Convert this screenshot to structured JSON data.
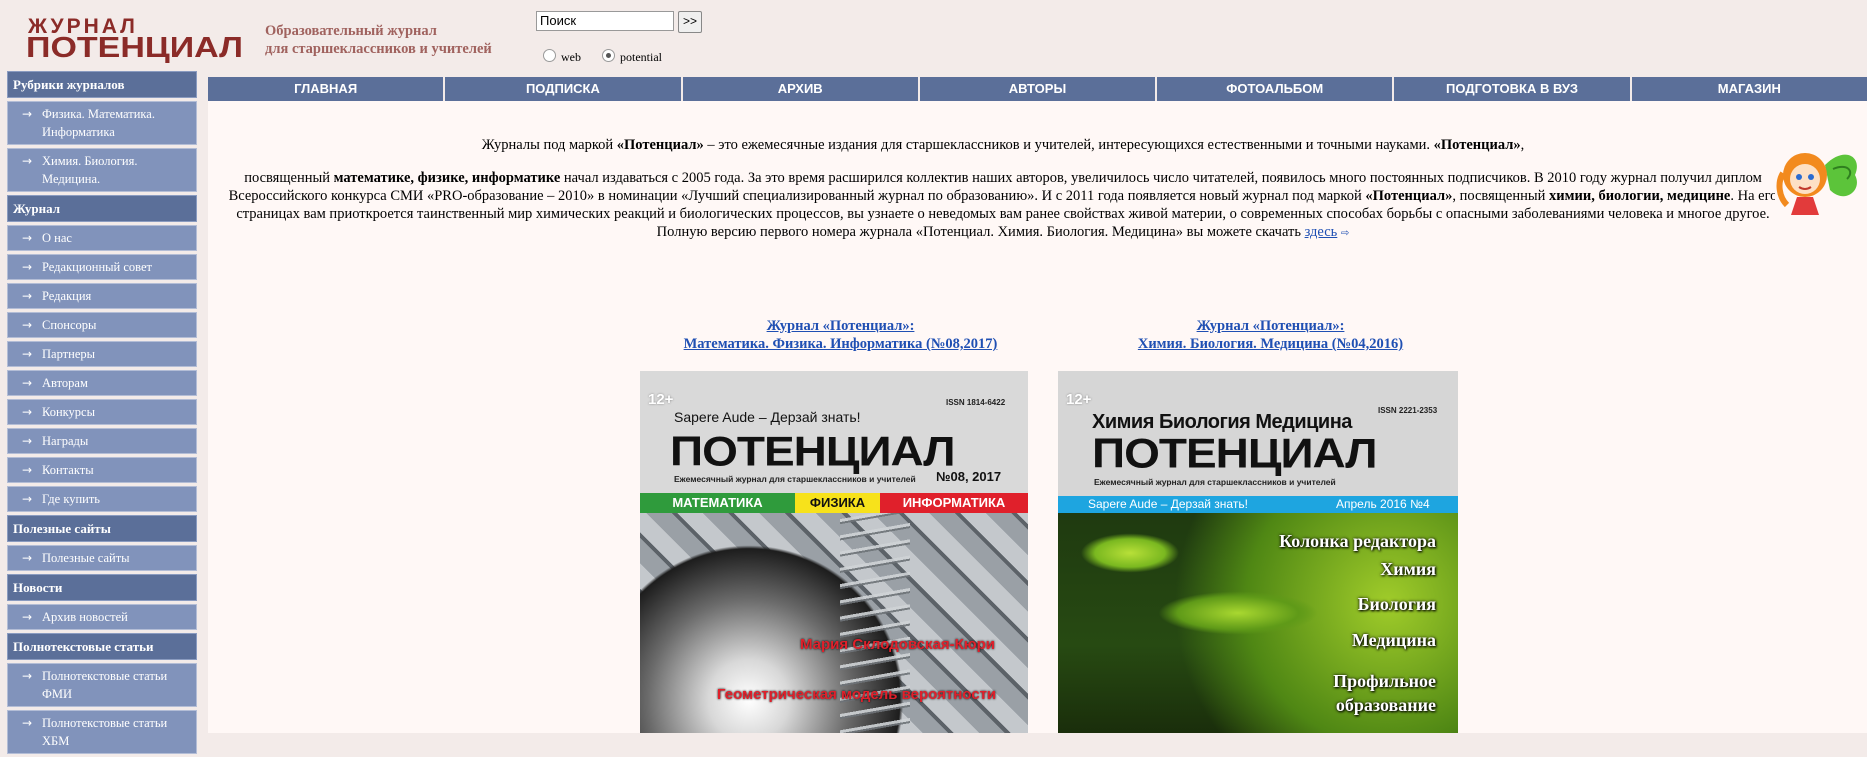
{
  "header": {
    "logo_top": "ЖУРНАЛ",
    "logo_main": "ПОТЕНЦИАЛ",
    "tagline_line1": "Образовательный журнал",
    "tagline_line2": "для старшеклассников и учителей",
    "search": {
      "value": "Поиск",
      "button": ">>"
    },
    "radio": [
      {
        "label": "web",
        "checked": false
      },
      {
        "label": "potential",
        "checked": true
      }
    ]
  },
  "sidebar": {
    "sections": [
      {
        "title": "Рубрики журналов",
        "items": [
          "Физика. Математика. Информатика",
          "Химия. Биология. Медицина."
        ]
      },
      {
        "title": "Журнал",
        "items": [
          "О нас",
          "Редакционный совет",
          "Редакция",
          "Спонсоры",
          "Партнеры",
          "Авторам",
          "Конкурсы",
          "Награды",
          "Контакты",
          "Где купить"
        ]
      },
      {
        "title": "Полезные сайты",
        "items": [
          "Полезные сайты"
        ]
      },
      {
        "title": "Новости",
        "items": [
          "Архив новостей"
        ]
      },
      {
        "title": "Полнотекстовые статьи",
        "items": [
          "Полнотекстовые статьи ФМИ",
          "Полнотекстовые статьи ХБМ"
        ]
      }
    ]
  },
  "nav": [
    "ГЛАВНАЯ",
    "ПОДПИСКА",
    "АРХИВ",
    "АВТОРЫ",
    "ФОТОАЛЬБОМ",
    "ПОДГОТОВКА В ВУЗ",
    "МАГАЗИН"
  ],
  "intro": {
    "p1_a": "Журналы под маркой ",
    "p1_b": "«Потенциал»",
    "p1_c": " – это ежемесячные издания для старшеклассников и учителей, интересующихся естественными и точными науками. ",
    "p1_d": "«Потенциал»",
    "p1_e": ",",
    "p2_a": "посвященный ",
    "p2_b": "математике, физике, информатике",
    "p2_c": " начал издаваться с 2005 года. За это время расширился коллектив наших авторов, увеличилось число читателей, появилось много постоянных подписчиков. В 2010 году журнал получил диплом Всероссийского конкурса СМИ «PRO-образование – 2010» в номинации «Лучший специализированный журнал по образованию». И с 2011 года появляется новый журнал под маркой ",
    "p2_d": "«Потенциал»",
    "p2_e": ", посвященный ",
    "p2_f": "химии, биологии, медицине",
    "p2_g": ". На его страницах вам приоткроется таинственный мир химических реакций и биологических процессов, вы узнаете о неведомых вам ранее свойствах живой материи, о современных способах борьбы с опасными заболеваниями человека и многое другое.",
    "p3_a": "Полную версию первого номера журнала «Потенциал. Химия. Биология. Медицина» вы можете скачать ",
    "p3_link": "здесь"
  },
  "magazines": [
    {
      "title_line1": "Журнал «Потенциал»:",
      "title_line2": "Математика. Физика. Информатика (№08,2017)",
      "cover": {
        "age": "12+",
        "issn": "ISSN 1814-6422",
        "motto": "Sapere Aude – Дерзай знать!",
        "brand": "ПОТЕНЦИАЛ",
        "subtitle": "Ежемесячный журнал для старшеклассников и учителей",
        "issue": "№08, 2017",
        "subjects": [
          "МАТЕМАТИКА",
          "ФИЗИКА",
          "ИНФОРМАТИКА"
        ],
        "subject_colors": [
          "#2f9b3c",
          "#f7e21b",
          "#e0202b"
        ],
        "headline1": "Мария Склодовская-Кюри",
        "headline2": "Геометрическая модель вероятности"
      }
    },
    {
      "title_line1": "Журнал «Потенциал»:",
      "title_line2": "Химия. Биология. Медицина (№04,2016)",
      "cover": {
        "age": "12+",
        "issn": "ISSN 2221-2353",
        "title_top": "Химия Биология Медицина",
        "brand": "ПОТЕНЦИАЛ",
        "subtitle": "Ежемесячный журнал для старшеклассников и учителей",
        "motto": "Sapere Aude – Дерзай знать!",
        "issue": "Апрель 2016 №4",
        "menu": [
          "Колонка редактора",
          "Химия",
          "Биология",
          "Медицина",
          "Профильное",
          "образование"
        ]
      }
    }
  ],
  "colors": {
    "brand": "#8b2b28",
    "nav_bg": "#5b6f99",
    "sidebar_item_bg": "#8193bb",
    "link": "#1f4fb3"
  }
}
